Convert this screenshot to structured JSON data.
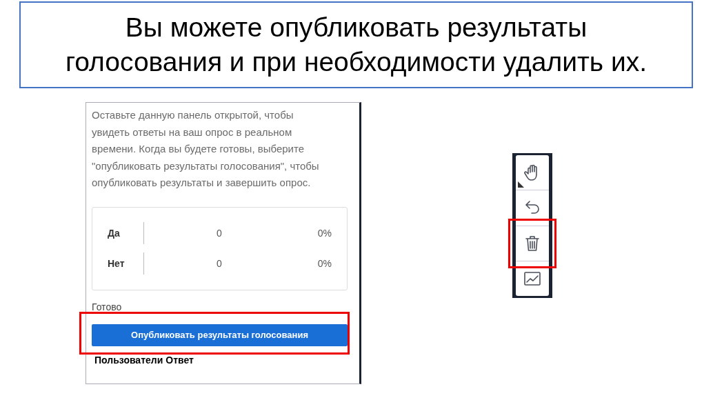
{
  "slide_title": {
    "lines": [
      "Вы можете опубликовать результаты",
      "голосования и при необходимости удалить их."
    ]
  },
  "poll_panel": {
    "instructions": "Оставьте данную панель открытой, чтобы увидеть ответы на ваш опрос в реальном времени. Когда вы будете готовы, выберите \"опубликовать результаты голосования\", чтобы опубликовать результаты и завершить опрос.",
    "results": [
      {
        "answer": "Да",
        "count": "0",
        "percent": "0%"
      },
      {
        "answer": "Нет",
        "count": "0",
        "percent": "0%"
      }
    ],
    "status": "Готово",
    "publish_button": {
      "label": "Опубликовать результаты голосования",
      "highlighted": true
    },
    "columns": [
      "Пользователи",
      "Ответ"
    ]
  },
  "toolbar": [
    {
      "kind": "hand",
      "highlighted": false
    },
    {
      "kind": "undo",
      "highlighted": false
    },
    {
      "kind": "trash",
      "highlighted": true
    },
    {
      "kind": "chart",
      "highlighted": false
    }
  ]
}
